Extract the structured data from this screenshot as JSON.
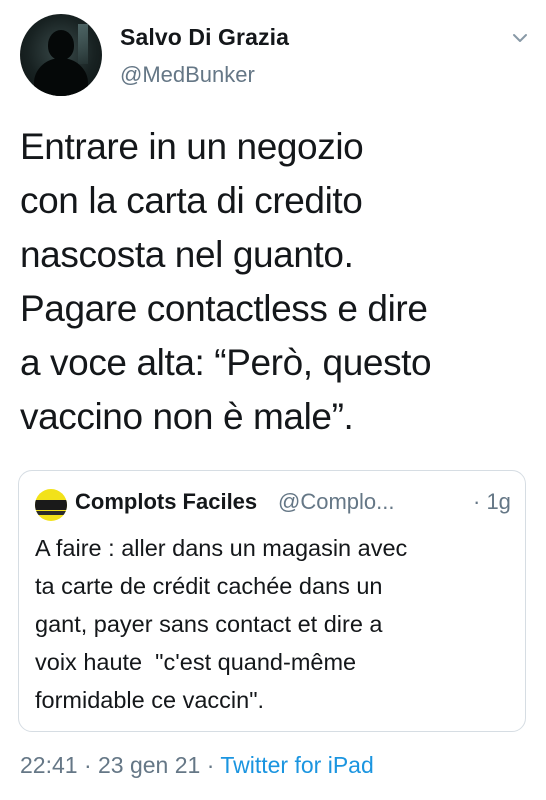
{
  "author": {
    "display_name": "Salvo Di Grazia",
    "handle": "@MedBunker"
  },
  "tweet": {
    "lines": [
      "Entrare in un negozio",
      "con la carta di credito",
      "nascosta nel guanto.",
      "Pagare contactless e dire",
      "a voce alta: “Però, questo",
      "vaccino non è male”."
    ]
  },
  "quoted_tweet": {
    "display_name": "Complots Faciles",
    "handle": "@Complo...",
    "time": "· 1g",
    "lines": [
      "A faire : aller dans un magasin avec",
      "ta carte de crédit cachée dans un",
      "gant, payer sans contact et dire a",
      "voix haute  \"c'est quand-même",
      "formidable ce vaccin\"."
    ]
  },
  "meta": {
    "timestamp": "22:41 · 23 gen 21 ·",
    "source": "Twitter for iPad"
  },
  "icons": {
    "caret": "chevron-down-icon",
    "avatar": "profile-avatar",
    "quote_avatar": "complots-faciles-avatar"
  },
  "colors": {
    "text": "#14171a",
    "secondary": "#657786",
    "link": "#1b95e0",
    "border": "#d6dde3"
  }
}
